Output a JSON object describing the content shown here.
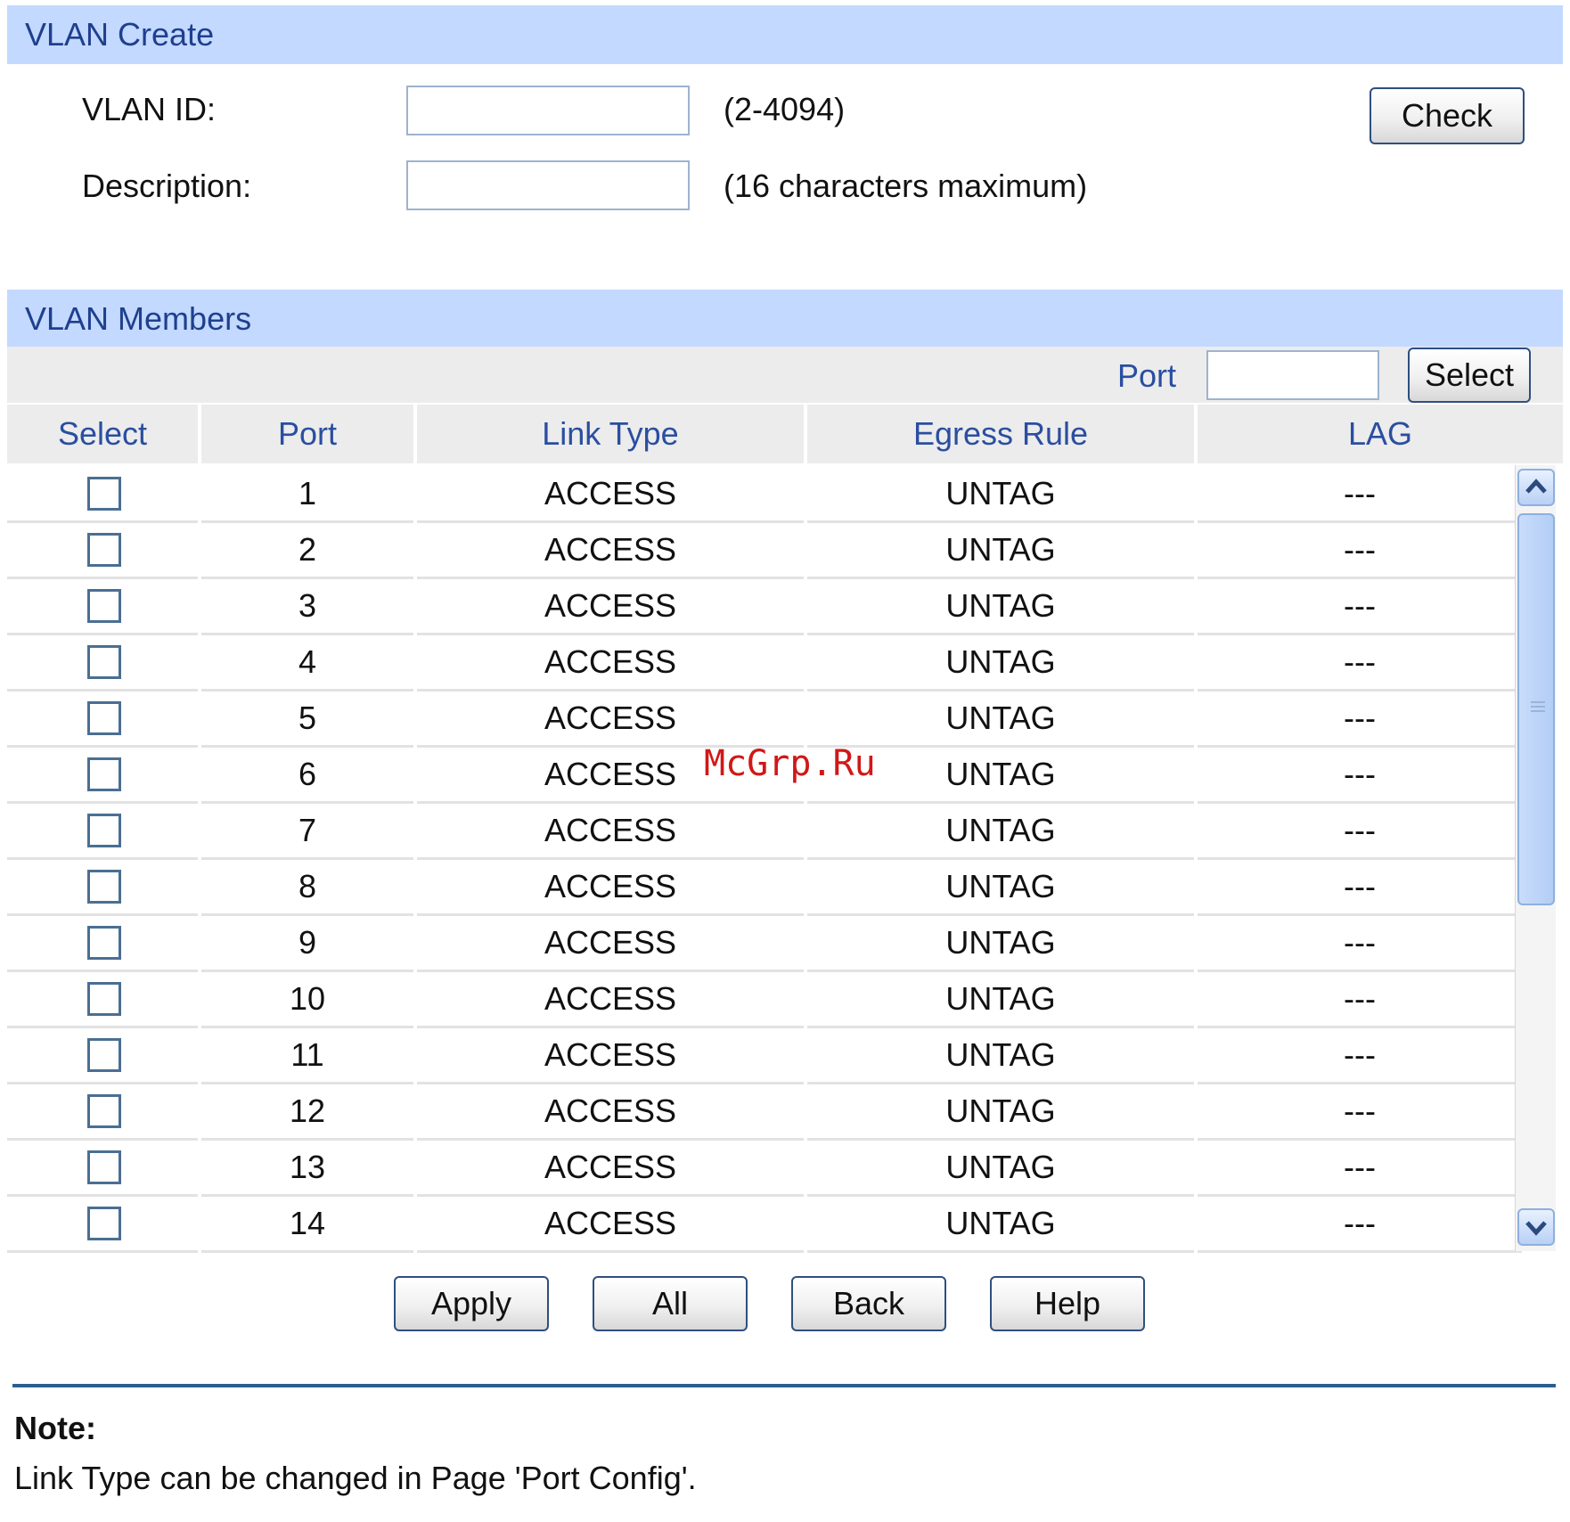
{
  "vlan_create": {
    "title": "VLAN Create",
    "vlan_id_label": "VLAN ID:",
    "vlan_id_value": "",
    "vlan_id_hint": "(2-4094)",
    "description_label": "Description:",
    "description_value": "",
    "description_hint": "(16 characters maximum)",
    "check_label": "Check"
  },
  "vlan_members": {
    "title": "VLAN Members",
    "port_filter_label": "Port",
    "port_filter_value": "",
    "select_label": "Select",
    "columns": [
      "Select",
      "Port",
      "Link Type",
      "Egress Rule",
      "LAG"
    ],
    "rows": [
      {
        "checked": false,
        "port": "1",
        "link_type": "ACCESS",
        "egress_rule": "UNTAG",
        "lag": "---"
      },
      {
        "checked": false,
        "port": "2",
        "link_type": "ACCESS",
        "egress_rule": "UNTAG",
        "lag": "---"
      },
      {
        "checked": false,
        "port": "3",
        "link_type": "ACCESS",
        "egress_rule": "UNTAG",
        "lag": "---"
      },
      {
        "checked": false,
        "port": "4",
        "link_type": "ACCESS",
        "egress_rule": "UNTAG",
        "lag": "---"
      },
      {
        "checked": false,
        "port": "5",
        "link_type": "ACCESS",
        "egress_rule": "UNTAG",
        "lag": "---"
      },
      {
        "checked": false,
        "port": "6",
        "link_type": "ACCESS",
        "egress_rule": "UNTAG",
        "lag": "---"
      },
      {
        "checked": false,
        "port": "7",
        "link_type": "ACCESS",
        "egress_rule": "UNTAG",
        "lag": "---"
      },
      {
        "checked": false,
        "port": "8",
        "link_type": "ACCESS",
        "egress_rule": "UNTAG",
        "lag": "---"
      },
      {
        "checked": false,
        "port": "9",
        "link_type": "ACCESS",
        "egress_rule": "UNTAG",
        "lag": "---"
      },
      {
        "checked": false,
        "port": "10",
        "link_type": "ACCESS",
        "egress_rule": "UNTAG",
        "lag": "---"
      },
      {
        "checked": false,
        "port": "11",
        "link_type": "ACCESS",
        "egress_rule": "UNTAG",
        "lag": "---"
      },
      {
        "checked": false,
        "port": "12",
        "link_type": "ACCESS",
        "egress_rule": "UNTAG",
        "lag": "---"
      },
      {
        "checked": false,
        "port": "13",
        "link_type": "ACCESS",
        "egress_rule": "UNTAG",
        "lag": "---"
      },
      {
        "checked": false,
        "port": "14",
        "link_type": "ACCESS",
        "egress_rule": "UNTAG",
        "lag": "---"
      }
    ]
  },
  "actions": {
    "apply_label": "Apply",
    "all_label": "All",
    "back_label": "Back",
    "help_label": "Help"
  },
  "note": {
    "title": "Note:",
    "text": "Link Type can be changed in Page 'Port Config'."
  },
  "watermark": "McGrp.Ru",
  "colors": {
    "section_header_bg": "#c3d9ff",
    "section_header_text": "#1f3f8f",
    "column_header_text": "#2a4ea0",
    "toolbar_bg": "#ececec",
    "divider": "#2a5f8f",
    "watermark": "#d01818"
  },
  "icons": {
    "scroll_up": "chevron-up-icon",
    "scroll_down": "chevron-down-icon",
    "scroll_grip": "grip-icon"
  }
}
